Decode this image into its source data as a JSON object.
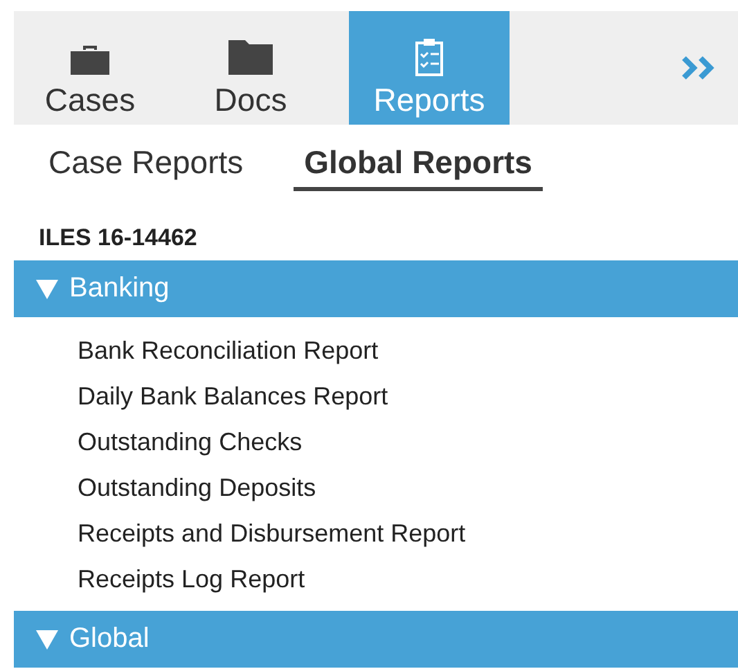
{
  "toolbar": {
    "tabs": [
      {
        "label": "Cases",
        "kind": "briefcase",
        "selected": false
      },
      {
        "label": "Docs",
        "kind": "folder",
        "selected": false
      },
      {
        "label": "Reports",
        "kind": "clipboard",
        "selected": true
      }
    ]
  },
  "subtabs": [
    {
      "label": "Case Reports",
      "selected": false
    },
    {
      "label": "Global Reports",
      "selected": true
    }
  ],
  "case_id": "ILES 16-14462",
  "groups": [
    {
      "label": "Banking",
      "expanded": true,
      "items": [
        "Bank Reconciliation Report",
        "Daily Bank Balances Report",
        "Outstanding Checks",
        "Outstanding Deposits",
        "Receipts and Disbursement Report",
        "Receipts Log Report"
      ]
    },
    {
      "label": "Global",
      "expanded": true
    }
  ]
}
